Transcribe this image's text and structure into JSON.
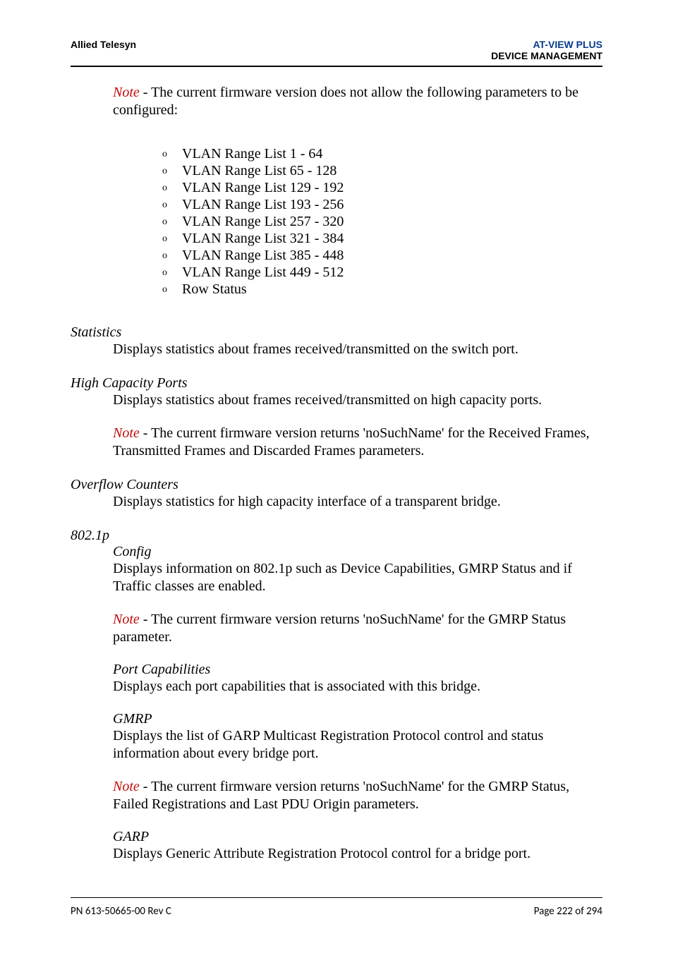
{
  "header": {
    "left": "Allied Telesyn",
    "right_line1": "AT-VIEW PLUS",
    "right_line2": "DEVICE MANAGEMENT"
  },
  "intro_note": {
    "label": "Note",
    "text": " - The current firmware version does not allow the following parameters to be configured:"
  },
  "vlan_items": [
    "VLAN Range List 1 - 64",
    "VLAN Range List 65 - 128",
    "VLAN Range List 129 - 192",
    "VLAN Range List 193 - 256",
    "VLAN Range List 257 - 320",
    "VLAN Range List 321 - 384",
    "VLAN Range List 385 - 448",
    "VLAN Range List 449 - 512",
    "Row Status"
  ],
  "statistics": {
    "title": "Statistics",
    "text": "Displays statistics about frames received/transmitted on the switch port."
  },
  "hcp": {
    "title": "High Capacity Ports",
    "text": "Displays statistics about frames received/transmitted on high capacity ports.",
    "note_label": "Note",
    "note_text": " - The current firmware version returns 'noSuchName' for the Received Frames, Transmitted Frames and Discarded Frames parameters."
  },
  "overflow": {
    "title": "Overflow Counters",
    "text": "Displays statistics for high capacity interface of a transparent bridge."
  },
  "p8021": {
    "title": "802.1p",
    "config_title": "Config",
    "config_text": "Displays information on 802.1p such as Device Capabilities, GMRP Status and if Traffic classes are enabled.",
    "config_note_label": "Note",
    "config_note_text": " - The current firmware version returns 'noSuchName' for the GMRP Status parameter.",
    "portcap_title": "Port Capabilities",
    "portcap_text": "Displays each port capabilities that is associated with this bridge.",
    "gmrp_title": "GMRP",
    "gmrp_text": "Displays the list of GARP Multicast Registration Protocol control and status information about every bridge port.",
    "gmrp_note_label": "Note",
    "gmrp_note_text": " - The current firmware version returns 'noSuchName' for the GMRP Status, Failed Registrations and Last PDU Origin parameters.",
    "garp_title": "GARP",
    "garp_text": "Displays Generic Attribute Registration Protocol control for a bridge port."
  },
  "footer": {
    "left": "PN 613-50665-00 Rev C",
    "right": "Page 222 of 294"
  },
  "bullet_char": "o"
}
